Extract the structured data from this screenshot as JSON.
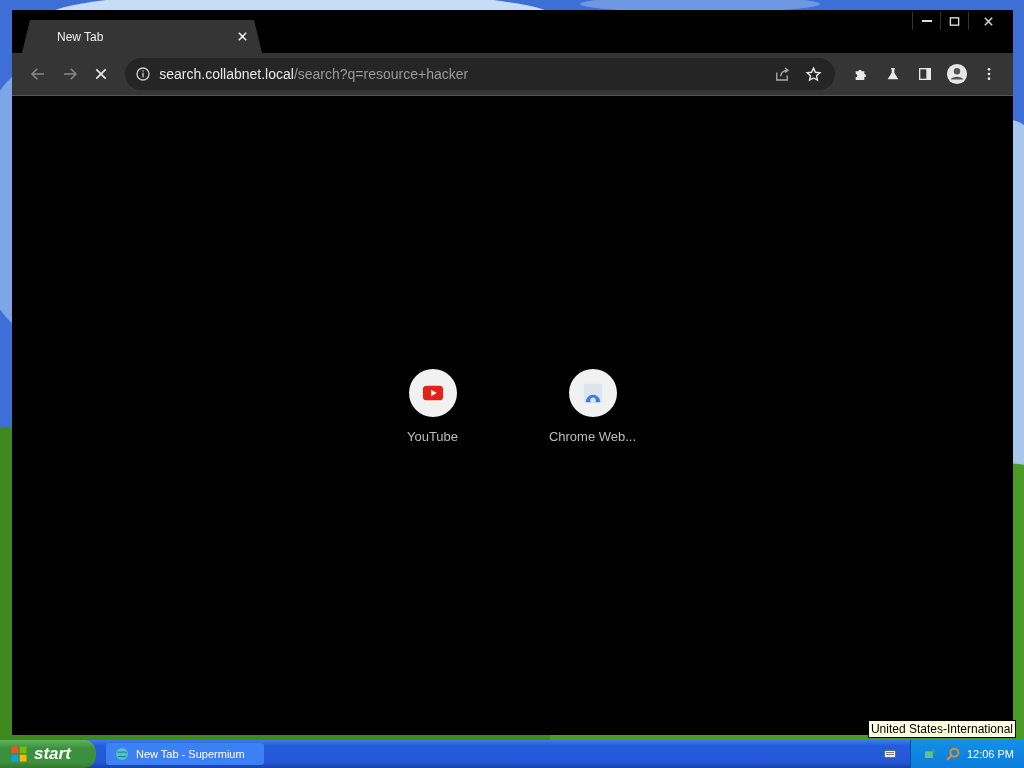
{
  "window": {
    "tabs": [
      {
        "title": "New Tab",
        "selected": true
      }
    ],
    "toolbar": {
      "loading": true,
      "url_host": "search.collabnet.local",
      "url_path": "/search?q=resource+hacker"
    },
    "shortcuts": [
      {
        "label": "YouTube",
        "kind": "youtube"
      },
      {
        "label": "Chrome Web...",
        "kind": "webstore"
      }
    ]
  },
  "tooltip": "United States-International",
  "taskbar": {
    "start": "start",
    "tasks": [
      {
        "label": "New Tab - Supermium",
        "selected": false
      }
    ],
    "clock": "12:06 PM"
  }
}
